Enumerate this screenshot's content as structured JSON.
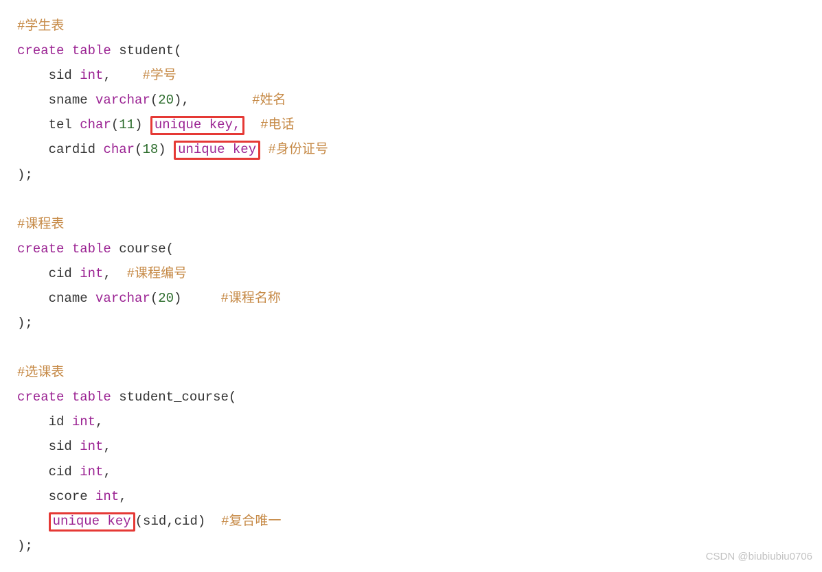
{
  "code": {
    "c1": "#学生表",
    "kw_create": "create",
    "kw_table": "table",
    "tbl_student": "student",
    "open": "(",
    "close": ")",
    "semi": ";",
    "comma": ",",
    "col_sid": "sid",
    "type_int": "int",
    "c_sid": "#学号",
    "col_sname": "sname",
    "type_varchar": "varchar",
    "num20": "20",
    "c_sname": "#姓名",
    "col_tel": "tel",
    "type_char": "char",
    "num11": "11",
    "hl_unique_key_comma": "unique key,",
    "c_tel": "#电话",
    "col_cardid": "cardid",
    "num18": "18",
    "hl_unique_key": "unique key",
    "c_cardid": "#身份证号",
    "c2": "#课程表",
    "tbl_course": "course",
    "col_cid": "cid",
    "c_cid": "#课程编号",
    "col_cname": "cname",
    "c_cname": "#课程名称",
    "c3": "#选课表",
    "tbl_sc": "student_course",
    "col_id": "id",
    "col_score": "score",
    "sc_args": "(sid,cid)",
    "c_composite": "#复合唯一",
    "watermark": "CSDN @biubiubiu0706"
  }
}
